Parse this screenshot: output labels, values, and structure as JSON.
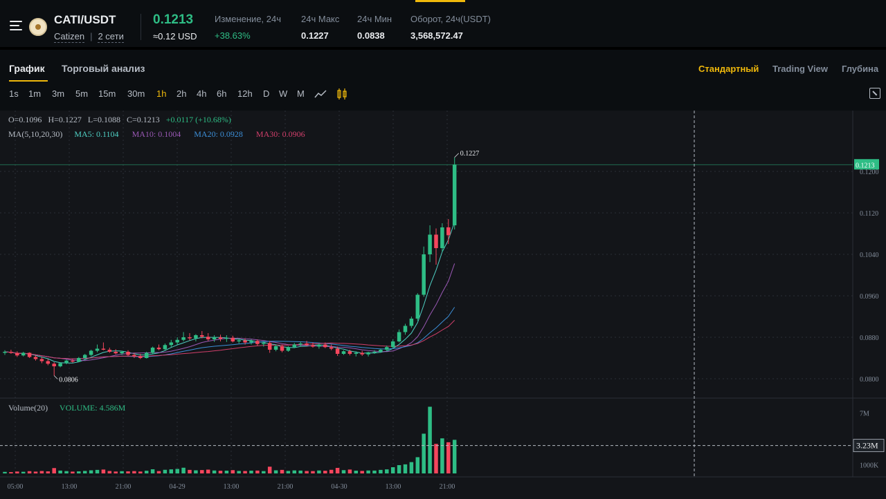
{
  "ticker": {
    "pair": "CATI/USDT",
    "coin_name": "Catizen",
    "networks": "2 сети",
    "price": "0.1213",
    "price_usd": "≈0.12 USD",
    "change_label": "Изменение, 24ч",
    "change_value": "+38.63%",
    "high_label": "24ч Макс",
    "high_value": "0.1227",
    "low_label": "24ч Мин",
    "low_value": "0.0838",
    "volume_label": "Оборот, 24ч(USDT)",
    "volume_value": "3,568,572.47"
  },
  "tabs": [
    "График",
    "Торговый анализ"
  ],
  "views": [
    "Стандартный",
    "Trading View",
    "Глубина"
  ],
  "intervals": [
    "1s",
    "1m",
    "3m",
    "5m",
    "15m",
    "30m",
    "1h",
    "2h",
    "4h",
    "6h",
    "12h",
    "D",
    "W",
    "M"
  ],
  "active_interval": "1h",
  "legend": {
    "ohlc": {
      "o": "O=0.1096",
      "h": "H=0.1227",
      "l": "L=0.1088",
      "c": "C=0.1213",
      "chg": "+0.0117 (+10.68%)"
    },
    "ma_label": "MA(5,10,20,30)",
    "ma5": "MA5: 0.1104",
    "ma10": "MA10: 0.1004",
    "ma20": "MA20: 0.0928",
    "ma30": "MA30: 0.0906",
    "volume_label": "Volume(20)",
    "volume_value": "VOLUME: 4.586M"
  },
  "colors": {
    "up": "#2ebd85",
    "down": "#f6465d",
    "accent": "#f0b90b"
  },
  "chart_data": {
    "type": "candlestick",
    "interval": "1h",
    "y_ticks": [
      "0.1200",
      "0.1120",
      "0.1040",
      "0.0960",
      "0.0880",
      "0.0800"
    ],
    "x_ticks": [
      "05:00",
      "13:00",
      "21:00",
      "04-29",
      "13:00",
      "21:00",
      "04-30",
      "13:00",
      "21:00"
    ],
    "volume_ticks": [
      "7M",
      "1000K"
    ],
    "last_price_tag": "0.1213",
    "high_marker": "0.1227",
    "low_marker": "0.0806",
    "volume_tag": "3.23M",
    "ylim": [
      0.078,
      0.127
    ],
    "volume_max": 8.0,
    "candles": [
      [
        0.085,
        0.0855,
        0.0846,
        0.0852
      ],
      [
        0.0852,
        0.0856,
        0.0848,
        0.085
      ],
      [
        0.085,
        0.0853,
        0.0842,
        0.0845
      ],
      [
        0.0845,
        0.0852,
        0.0843,
        0.085
      ],
      [
        0.085,
        0.0851,
        0.084,
        0.0842
      ],
      [
        0.0842,
        0.0845,
        0.0835,
        0.0838
      ],
      [
        0.0838,
        0.0842,
        0.083,
        0.0834
      ],
      [
        0.0834,
        0.0838,
        0.0826,
        0.0829
      ],
      [
        0.0829,
        0.0832,
        0.0806,
        0.0824
      ],
      [
        0.0824,
        0.0832,
        0.0822,
        0.083
      ],
      [
        0.083,
        0.0837,
        0.0828,
        0.0835
      ],
      [
        0.0835,
        0.0838,
        0.0831,
        0.0833
      ],
      [
        0.0833,
        0.0842,
        0.0832,
        0.084
      ],
      [
        0.084,
        0.0848,
        0.0838,
        0.0846
      ],
      [
        0.0846,
        0.0856,
        0.0844,
        0.0854
      ],
      [
        0.0854,
        0.0866,
        0.0851,
        0.0858
      ],
      [
        0.0858,
        0.087,
        0.0855,
        0.0856
      ],
      [
        0.0856,
        0.086,
        0.085,
        0.0852
      ],
      [
        0.0852,
        0.0857,
        0.0847,
        0.0849
      ],
      [
        0.0849,
        0.0854,
        0.0846,
        0.0852
      ],
      [
        0.0852,
        0.0855,
        0.0844,
        0.0846
      ],
      [
        0.0846,
        0.085,
        0.084,
        0.0843
      ],
      [
        0.0843,
        0.0848,
        0.0838,
        0.084
      ],
      [
        0.084,
        0.0852,
        0.0839,
        0.085
      ],
      [
        0.085,
        0.0862,
        0.0848,
        0.086
      ],
      [
        0.086,
        0.0866,
        0.0855,
        0.0857
      ],
      [
        0.0857,
        0.0868,
        0.0855,
        0.0865
      ],
      [
        0.0865,
        0.0875,
        0.0861,
        0.087
      ],
      [
        0.087,
        0.088,
        0.0865,
        0.0875
      ],
      [
        0.0875,
        0.089,
        0.0872,
        0.088
      ],
      [
        0.088,
        0.0888,
        0.0874,
        0.0878
      ],
      [
        0.0878,
        0.0886,
        0.0872,
        0.0884
      ],
      [
        0.0884,
        0.0892,
        0.0878,
        0.0881
      ],
      [
        0.0881,
        0.0888,
        0.0873,
        0.0876
      ],
      [
        0.0876,
        0.0884,
        0.0871,
        0.088
      ],
      [
        0.088,
        0.0885,
        0.0872,
        0.0877
      ],
      [
        0.0877,
        0.0884,
        0.0871,
        0.0879
      ],
      [
        0.0879,
        0.0883,
        0.087,
        0.0872
      ],
      [
        0.0872,
        0.0878,
        0.0868,
        0.0874
      ],
      [
        0.0874,
        0.0878,
        0.0866,
        0.087
      ],
      [
        0.087,
        0.0876,
        0.0866,
        0.0873
      ],
      [
        0.0873,
        0.0876,
        0.0864,
        0.0867
      ],
      [
        0.0867,
        0.0872,
        0.0862,
        0.0869
      ],
      [
        0.0869,
        0.0873,
        0.085,
        0.0856
      ],
      [
        0.0856,
        0.0866,
        0.0853,
        0.0863
      ],
      [
        0.0863,
        0.0866,
        0.0851,
        0.0854
      ],
      [
        0.0854,
        0.0863,
        0.0852,
        0.0861
      ],
      [
        0.0861,
        0.0869,
        0.0859,
        0.0866
      ],
      [
        0.0866,
        0.0872,
        0.0862,
        0.0868
      ],
      [
        0.0868,
        0.0873,
        0.0863,
        0.0865
      ],
      [
        0.0865,
        0.087,
        0.086,
        0.0862
      ],
      [
        0.0862,
        0.0868,
        0.0858,
        0.0866
      ],
      [
        0.0866,
        0.087,
        0.0859,
        0.0861
      ],
      [
        0.0861,
        0.0866,
        0.0855,
        0.0858
      ],
      [
        0.0858,
        0.0862,
        0.0844,
        0.0848
      ],
      [
        0.0848,
        0.0855,
        0.0846,
        0.0853
      ],
      [
        0.0853,
        0.0856,
        0.0845,
        0.0848
      ],
      [
        0.0848,
        0.0853,
        0.0843,
        0.085
      ],
      [
        0.085,
        0.0854,
        0.0844,
        0.0847
      ],
      [
        0.0847,
        0.0852,
        0.0843,
        0.0851
      ],
      [
        0.0851,
        0.0855,
        0.0848,
        0.0852
      ],
      [
        0.0852,
        0.0858,
        0.085,
        0.0856
      ],
      [
        0.0856,
        0.0864,
        0.0854,
        0.0861
      ],
      [
        0.0861,
        0.0876,
        0.0859,
        0.0872
      ],
      [
        0.0872,
        0.0895,
        0.087,
        0.089
      ],
      [
        0.089,
        0.0906,
        0.0885,
        0.0902
      ],
      [
        0.0902,
        0.092,
        0.0898,
        0.0916
      ],
      [
        0.0916,
        0.0965,
        0.0912,
        0.0962
      ],
      [
        0.0962,
        0.1055,
        0.0958,
        0.104
      ],
      [
        0.104,
        0.1096,
        0.1025,
        0.1078
      ],
      [
        0.1078,
        0.109,
        0.102,
        0.1052
      ],
      [
        0.1052,
        0.11,
        0.1045,
        0.1092
      ],
      [
        0.1092,
        0.1108,
        0.106,
        0.1077
      ],
      [
        0.1096,
        0.1227,
        0.1088,
        0.1213
      ]
    ],
    "volume": [
      0.18,
      0.15,
      0.22,
      0.19,
      0.26,
      0.21,
      0.28,
      0.24,
      0.62,
      0.33,
      0.27,
      0.21,
      0.24,
      0.29,
      0.36,
      0.41,
      0.45,
      0.28,
      0.22,
      0.26,
      0.24,
      0.27,
      0.22,
      0.31,
      0.48,
      0.27,
      0.42,
      0.47,
      0.52,
      0.66,
      0.41,
      0.36,
      0.39,
      0.44,
      0.34,
      0.31,
      0.32,
      0.38,
      0.29,
      0.28,
      0.32,
      0.33,
      0.27,
      0.78,
      0.36,
      0.41,
      0.29,
      0.35,
      0.33,
      0.28,
      0.27,
      0.34,
      0.31,
      0.42,
      0.64,
      0.38,
      0.45,
      0.32,
      0.29,
      0.34,
      0.33,
      0.41,
      0.47,
      0.72,
      0.96,
      1.05,
      1.31,
      1.88,
      4.6,
      7.72,
      3.42,
      4.06,
      3.61,
      3.89
    ]
  }
}
